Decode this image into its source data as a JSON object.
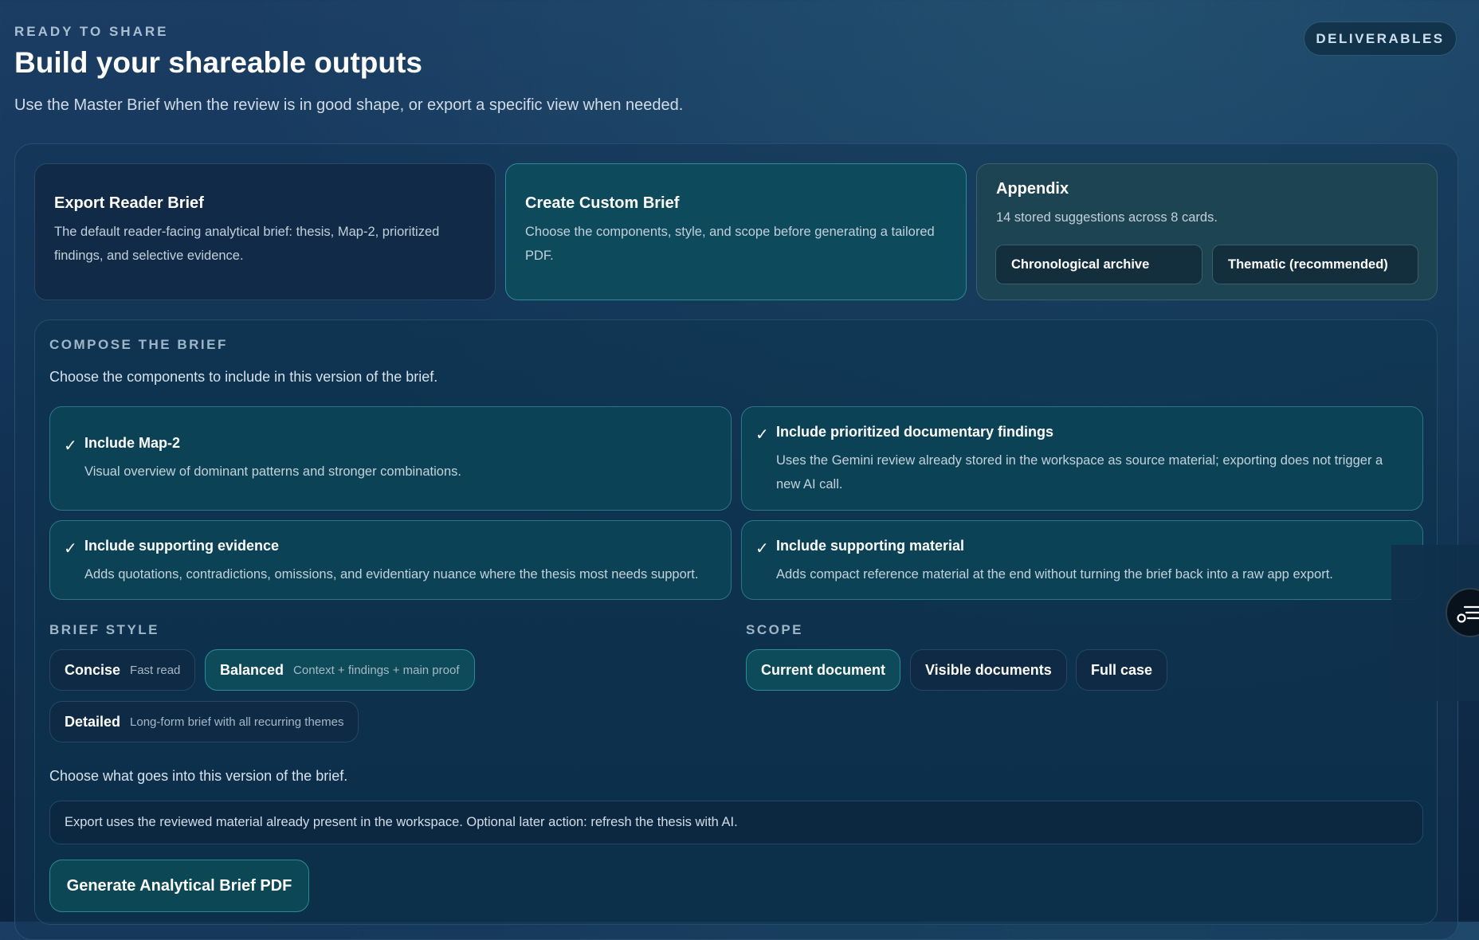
{
  "header": {
    "eyebrow": "READY TO SHARE",
    "title": "Build your shareable outputs",
    "subtitle": "Use the Master Brief when the review is in good shape, or export a specific view when needed.",
    "deliverables_label": "DELIVERABLES"
  },
  "cards": {
    "reader": {
      "title": "Export Reader Brief",
      "line1": "The default reader-facing analytical brief: thesis, Map-2, prioritized",
      "line2": "findings, and selective evidence."
    },
    "custom": {
      "title": "Create Custom Brief",
      "line1": "Choose the components, style, and scope before generating a tailored",
      "line2": "PDF."
    },
    "appendix": {
      "title": "Appendix",
      "desc": "14 stored suggestions across 8 cards.",
      "options": [
        "Chronological archive",
        "Thematic (recommended)"
      ]
    }
  },
  "compose": {
    "label": "COMPOSE THE BRIEF",
    "intro": "Choose the components to include in this version of the brief.",
    "check_glyph": "✓",
    "components": [
      {
        "title": "Include Map-2",
        "line1": "Visual overview of dominant patterns and stronger combinations.",
        "line2": "",
        "checked": true
      },
      {
        "title": "Include prioritized documentary findings",
        "line1": "Uses the Gemini review already stored in the workspace as source material; exporting does not trigger a",
        "line2": "new AI call.",
        "checked": true
      },
      {
        "title": "Include supporting evidence",
        "line1": "Adds quotations, contradictions, omissions, and evidentiary nuance where the thesis most needs support.",
        "line2": "",
        "checked": true
      },
      {
        "title": "Include supporting material",
        "line1": "Adds compact reference material at the end without turning the brief back into a raw app export.",
        "line2": "",
        "checked": true
      }
    ],
    "style": {
      "label": "BRIEF STYLE",
      "selected": "Balanced",
      "options": [
        {
          "title": "Concise",
          "sub": "Fast read"
        },
        {
          "title": "Balanced",
          "sub": "Context + findings + main proof"
        },
        {
          "title": "Detailed",
          "sub": "Long-form brief with all recurring themes"
        }
      ]
    },
    "scope": {
      "label": "SCOPE",
      "selected": "Current document",
      "options": [
        "Current document",
        "Visible documents",
        "Full case"
      ]
    },
    "what_goes": "Choose what goes into this version of the brief.",
    "note": "Export uses the reviewed material already present in the workspace. Optional later action: refresh the thesis with AI.",
    "generate_label": "Generate Analytical Brief PDF"
  },
  "colors": {
    "background": "#14365a",
    "accent": "#0c4a5c",
    "accent_border": "#2f8a9a"
  },
  "icons": {
    "floating_button": "settings-list-icon",
    "check": "check-icon"
  }
}
